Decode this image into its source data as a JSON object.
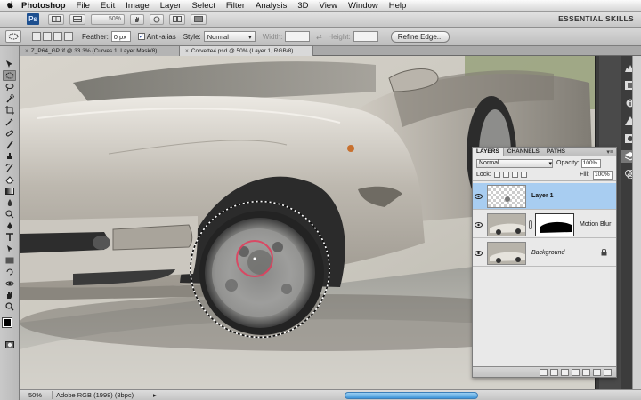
{
  "menubar": {
    "app_name": "Photoshop",
    "items": [
      "File",
      "Edit",
      "Image",
      "Layer",
      "Select",
      "Filter",
      "Analysis",
      "3D",
      "View",
      "Window",
      "Help"
    ]
  },
  "appbar": {
    "logo": "Ps",
    "zoom": "50%",
    "workspace": "ESSENTIAL SKILLS"
  },
  "options": {
    "feather_label": "Feather:",
    "feather_value": "0 px",
    "antialias_label": "Anti-alias",
    "antialias_checked": true,
    "style_label": "Style:",
    "style_value": "Normal",
    "width_label": "Width:",
    "height_label": "Height:",
    "refine_edge": "Refine Edge..."
  },
  "tabs": [
    {
      "label": "Z_P64_GP.tif @ 33.3% (Curves 1, Layer Mask/8)",
      "active": false
    },
    {
      "label": "Corvette4.psd @ 50% (Layer 1, RGB/8)",
      "active": true
    }
  ],
  "layers_panel": {
    "tabs": [
      "LAYERS",
      "CHANNELS",
      "PATHS"
    ],
    "blend_mode": "Normal",
    "opacity_label": "Opacity:",
    "opacity_value": "100%",
    "lock_label": "Lock:",
    "fill_label": "Fill:",
    "fill_value": "100%",
    "layers": [
      {
        "name": "Layer 1",
        "selected": true
      },
      {
        "name": "Motion Blur",
        "selected": false
      },
      {
        "name": "Background",
        "selected": false
      }
    ]
  },
  "status": {
    "zoom": "50%",
    "doc_info": "Adobe RGB (1998) (8bpc)"
  },
  "colors": {
    "selection_accent": "#a8cdf1",
    "scroll_accent": "#3f95d8",
    "brush_circle": "#e0405e"
  },
  "icons": {
    "tools": [
      "move-tool-icon",
      "marquee-tool-icon",
      "lasso-tool-icon",
      "quick-select-tool-icon",
      "crop-tool-icon",
      "eyedropper-tool-icon",
      "healing-brush-icon",
      "brush-tool-icon",
      "clone-stamp-icon",
      "history-brush-icon",
      "eraser-tool-icon",
      "gradient-tool-icon",
      "blur-tool-icon",
      "dodge-tool-icon",
      "pen-tool-icon",
      "type-tool-icon",
      "path-select-icon",
      "shape-tool-icon",
      "3d-rotate-icon",
      "3d-orbit-icon",
      "hand-tool-icon",
      "zoom-tool-icon"
    ]
  }
}
